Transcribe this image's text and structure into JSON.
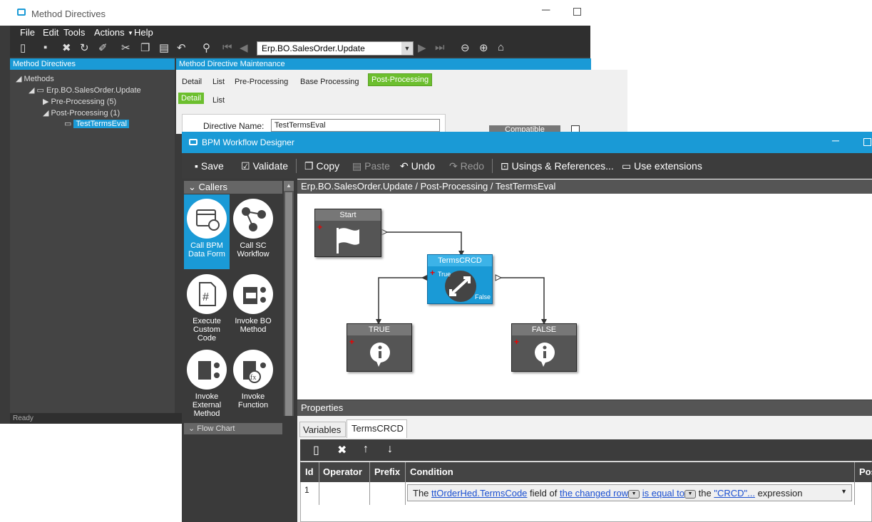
{
  "back_window": {
    "title": "Method Directives",
    "menu": [
      "File",
      "Edit",
      "Tools",
      "Actions",
      "Help"
    ],
    "combo_value": "Erp.BO.SalesOrder.Update",
    "tree_header": "Method Directives",
    "tree": {
      "root": "Methods",
      "method": "Erp.BO.SalesOrder.Update",
      "pre": "Pre-Processing (5)",
      "post": "Post-Processing (1)",
      "selected": "TestTermsEval"
    },
    "panel_header": "Method Directive Maintenance",
    "tabs": [
      "Detail",
      "List",
      "Pre-Processing",
      "Base Processing",
      "Post-Processing"
    ],
    "subtabs": [
      "Detail",
      "List"
    ],
    "directive_label": "Directive Name:",
    "directive_value": "TestTermsEval",
    "compatible_label": "Compatible",
    "status": "Ready"
  },
  "designer": {
    "title": "BPM Workflow Designer",
    "toolbar": {
      "save": "Save",
      "validate": "Validate",
      "copy": "Copy",
      "paste": "Paste",
      "undo": "Undo",
      "redo": "Redo",
      "usings": "Usings & References...",
      "extensions": "Use extensions"
    },
    "callers_label": "Callers",
    "palette": [
      "Call BPM Data Form",
      "Call SC Workflow",
      "Execute Custom Code",
      "Invoke BO Method",
      "Invoke External Method",
      "Invoke Function"
    ],
    "flowchart_label": "Flow Chart",
    "breadcrumb": "Erp.BO.SalesOrder.Update / Post-Processing / TestTermsEval",
    "nodes": {
      "start": "Start",
      "condition": "TermsCRCD",
      "true_port": "True",
      "false_port": "False",
      "true_node": "TRUE",
      "false_node": "FALSE"
    },
    "properties_label": "Properties",
    "prop_tabs": [
      "Variables",
      "TermsCRCD"
    ],
    "grid_columns": [
      "Id",
      "Operator",
      "Prefix",
      "Condition",
      "Pos"
    ],
    "row": {
      "id": "1",
      "operator": "",
      "prefix": "",
      "cond_the": "The",
      "cond_field": "ttOrderHed.TermsCode",
      "cond_field_of": "field of",
      "cond_row": "the changed row",
      "cond_op": "is equal to",
      "cond_the2": "the",
      "cond_value": "\"CRCD\"...",
      "cond_expr": "expression"
    }
  }
}
